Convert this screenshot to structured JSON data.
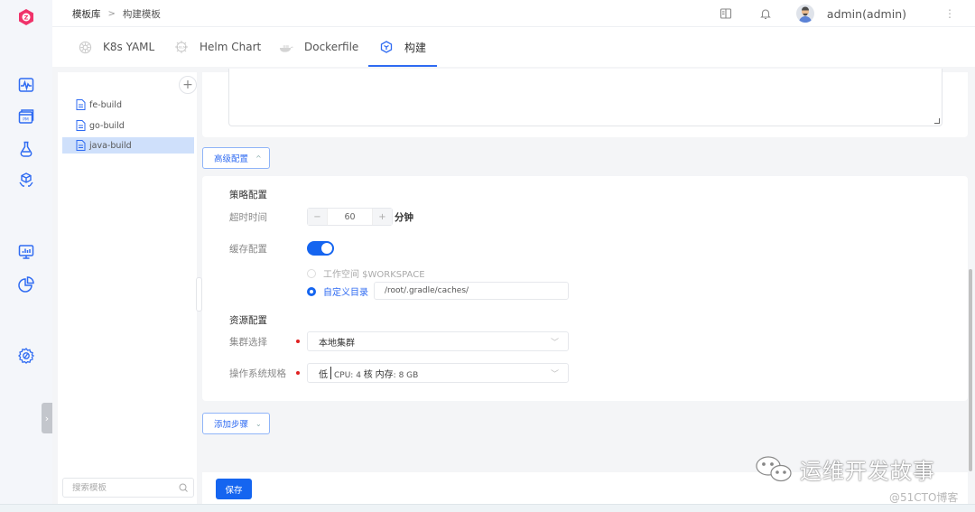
{
  "header": {
    "breadcrumb": [
      "模板库",
      "构建模板"
    ],
    "breadcrumb_sep": ">",
    "username": "admin(admin)"
  },
  "tabs": [
    {
      "label": "K8s YAML",
      "icon": "kubernetes-icon",
      "active": false
    },
    {
      "label": "Helm Chart",
      "icon": "helm-icon",
      "active": false
    },
    {
      "label": "Dockerfile",
      "icon": "docker-icon",
      "active": false
    },
    {
      "label": "构建",
      "icon": "build-cube-icon",
      "active": true
    }
  ],
  "sidebar": {
    "items": [
      {
        "icon": "pulse-monitor-icon"
      },
      {
        "icon": "pm-window-icon"
      },
      {
        "icon": "flask-icon"
      },
      {
        "icon": "package-hands-icon"
      },
      {
        "icon": "dashboard-chart-icon"
      },
      {
        "icon": "pie-chart-icon"
      },
      {
        "icon": "settings-icon"
      }
    ],
    "collapse_glyph": "›"
  },
  "templates": {
    "add_glyph": "+",
    "items": [
      {
        "name": "fe-build",
        "selected": false
      },
      {
        "name": "go-build",
        "selected": false
      },
      {
        "name": "java-build",
        "selected": true
      }
    ],
    "search_placeholder": "搜索模板"
  },
  "advanced": {
    "toggle_label": "高级配置",
    "toggle_glyph": "^",
    "strategy": {
      "title": "策略配置",
      "timeout_label": "超时时间",
      "timeout_value": "60",
      "timeout_unit": "分钟",
      "minus": "−",
      "plus": "+",
      "cache_label": "缓存配置",
      "cache_enabled": true,
      "cache_options": [
        {
          "label": "工作空间 $WORKSPACE",
          "selected": false
        },
        {
          "label": "自定义目录",
          "selected": true
        }
      ],
      "custom_dir": "/root/.gradle/caches/"
    },
    "resource": {
      "title": "资源配置",
      "cluster_label": "集群选择",
      "cluster_value": "本地集群",
      "spec_label": "操作系统规格",
      "spec_level": "低",
      "spec_cpu_label": "CPU: 4",
      "spec_cpu_unit": "核",
      "spec_mem_label": "内存",
      "spec_mem_value": ": 8 GB"
    }
  },
  "add_step": {
    "label": "添加步骤",
    "glyph": "⌄"
  },
  "footer": {
    "save_label": "保存"
  },
  "watermark": {
    "text": "运维开发故事",
    "source": "@51CTO博客"
  },
  "colors": {
    "primary": "#1565f0",
    "logo": "#f0336a",
    "required": "#e02020"
  }
}
